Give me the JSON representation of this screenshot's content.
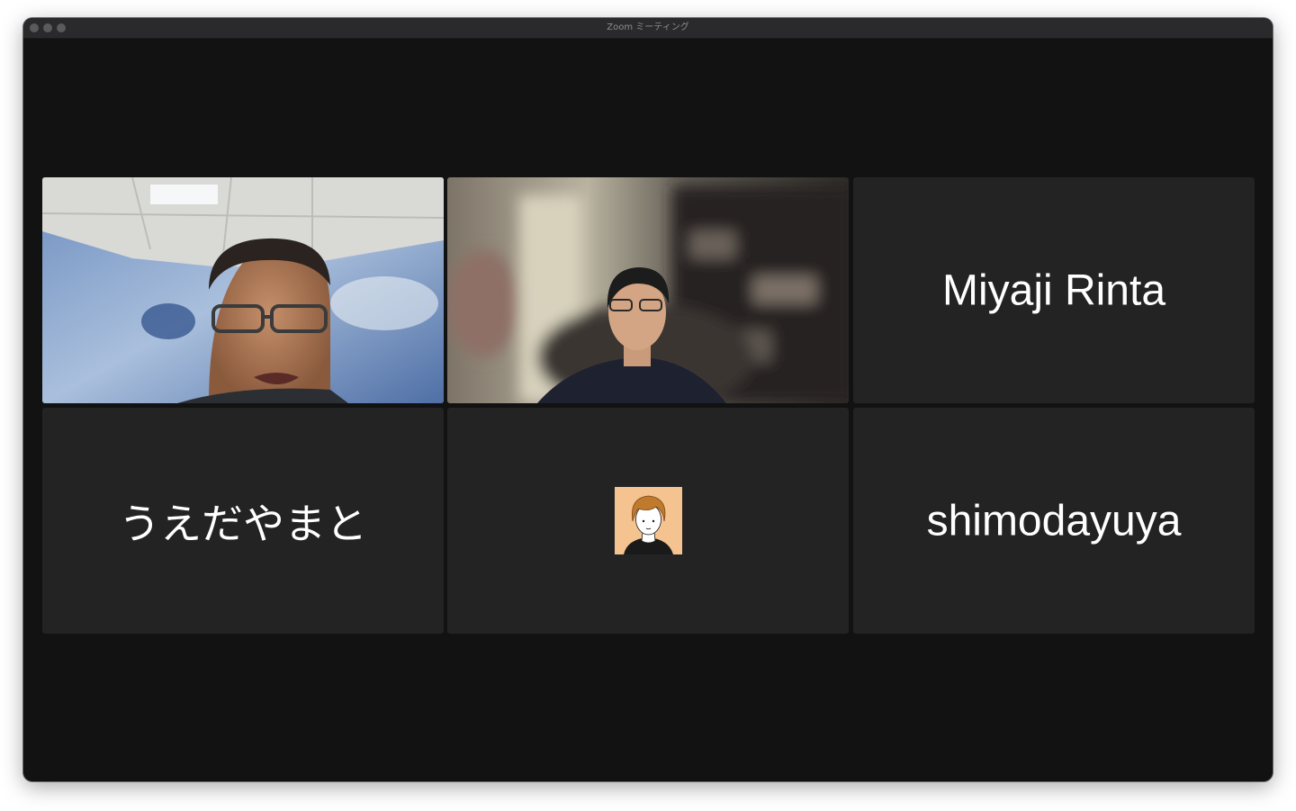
{
  "window": {
    "title": "Zoom ミーティング"
  },
  "participants": [
    {
      "name": "",
      "video": true,
      "active_speaker": true
    },
    {
      "name": "",
      "video": true,
      "active_speaker": false
    },
    {
      "name": "Miyaji Rinta",
      "video": false
    },
    {
      "name": "うえだやまと",
      "video": false
    },
    {
      "name": "",
      "video": false,
      "avatar": "user-avatar-illustration"
    },
    {
      "name": "shimodayuya",
      "video": false
    }
  ],
  "colors": {
    "background": "#121212",
    "tile": "#232323",
    "active_speaker_border": "#3fbf2f"
  }
}
